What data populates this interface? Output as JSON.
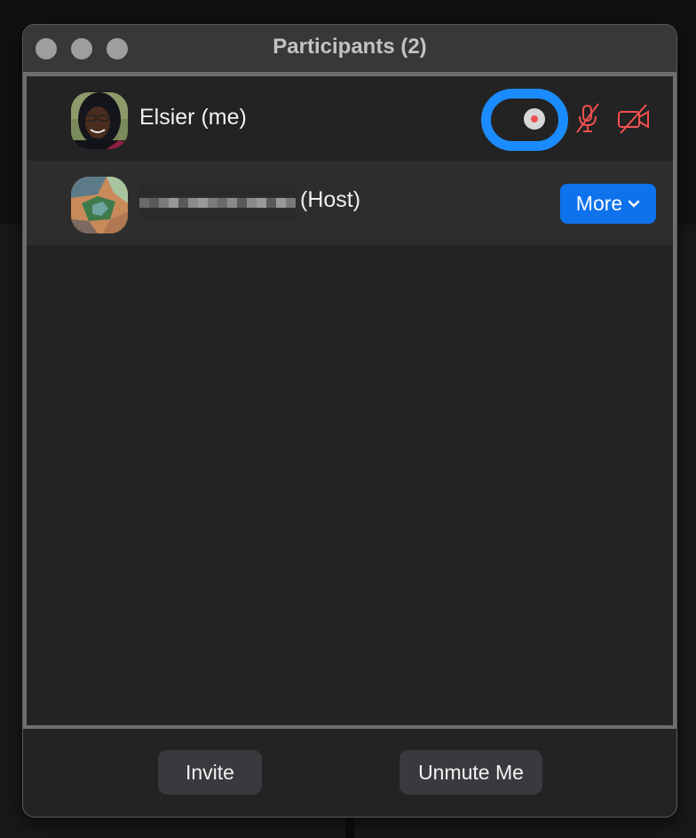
{
  "window": {
    "title": "Participants (2)",
    "traffic_lights": [
      "close",
      "minimize",
      "zoom"
    ]
  },
  "participants": [
    {
      "name": "Elsier (me)",
      "avatar": "photo-avatar-woman",
      "status_icons": [
        "recording-indicator-icon",
        "muted-microphone-icon",
        "video-off-icon"
      ],
      "recording_highlight_color": "#1a8cff",
      "muted_icon_color": "#f05050"
    },
    {
      "name_redacted": true,
      "role_label": "(Host)",
      "avatar": "landscape-avatar",
      "action_button": {
        "label": "More",
        "icon": "chevron-down-icon",
        "color": "#0e72ed"
      }
    }
  ],
  "footer": {
    "invite_label": "Invite",
    "unmute_label": "Unmute Me"
  }
}
